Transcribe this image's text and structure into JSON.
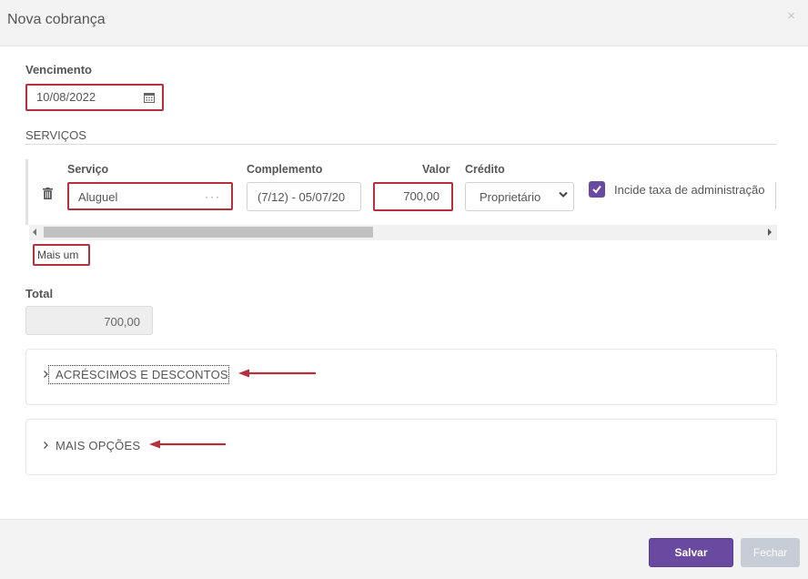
{
  "modal": {
    "title": "Nova cobrança",
    "close_glyph": "×"
  },
  "vencimento": {
    "label": "Vencimento",
    "value": "10/08/2022",
    "icon": "calendar-icon"
  },
  "servicos": {
    "section_title": "SERVIÇOS",
    "columns": {
      "servico": "Serviço",
      "complemento": "Complemento",
      "valor": "Valor",
      "credito": "Crédito"
    },
    "row": {
      "servico": "Aluguel",
      "servico_more": "···",
      "complemento": "(7/12) - 05/07/20",
      "valor": "700,00",
      "credito": "Proprietário",
      "incide_taxa_checked": true,
      "incide_taxa_label": "Incide taxa de administração"
    },
    "add_more": "Mais um"
  },
  "total": {
    "label": "Total",
    "value": "700,00"
  },
  "panels": {
    "acrescimos": "ACRÉSCIMOS E DESCONTOS",
    "mais_opcoes": "MAIS OPÇÕES"
  },
  "footer": {
    "save": "Salvar",
    "close": "Fechar"
  },
  "colors": {
    "accent": "#6a4aa0",
    "highlight": "#b5303c",
    "disabled": "#c7cdd6"
  }
}
